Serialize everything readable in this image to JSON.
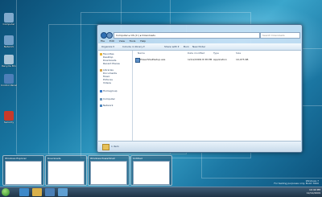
{
  "desktop": {
    "icons": [
      {
        "label": "Computer",
        "color": "#7fa9cc"
      },
      {
        "label": "Network",
        "color": "#6f9ec7"
      },
      {
        "label": "Recycle Bin",
        "color": "#a8c4d8"
      },
      {
        "label": "Control Panel",
        "color": "#4d7fb8"
      },
      {
        "label": "Security",
        "color": "#c83a2a"
      }
    ]
  },
  "explorer": {
    "address": "Computer ▸ OS (C:) ▸ Downloads",
    "search_placeholder": "Search Downloads",
    "menu": [
      "File",
      "Edit",
      "View",
      "Tools",
      "Help"
    ],
    "toolbar": [
      "Organize ▾",
      "Include in library ▾",
      "Share with ▾",
      "Burn",
      "New folder"
    ],
    "nav": {
      "favorites": "Favorites",
      "fav_items": [
        "Desktop",
        "Downloads",
        "Recent Places"
      ],
      "libraries": "Libraries",
      "lib_items": [
        "Documents",
        "Music",
        "Pictures",
        "Videos"
      ],
      "homegroup": "Homegroup",
      "computer": "Computer",
      "network": "Network"
    },
    "columns": [
      "Name",
      "Date modified",
      "Type",
      "Size"
    ],
    "files": [
      {
        "name": "PowerShellSetup.exe",
        "date": "12/12/2009 8:38 PM",
        "type": "Application",
        "size": "10,475 KB"
      }
    ],
    "details": "1 item"
  },
  "previews": [
    {
      "title": "Windows Explorer"
    },
    {
      "title": "Downloads"
    },
    {
      "title": "Windows PowerShell"
    },
    {
      "title": "Untitled"
    }
  ],
  "tray": {
    "time": "10:40 PM",
    "date": "12/12/2009"
  },
  "watermark": {
    "line1": "Windows 7",
    "line2": "For testing purposes only. Build 7600"
  }
}
